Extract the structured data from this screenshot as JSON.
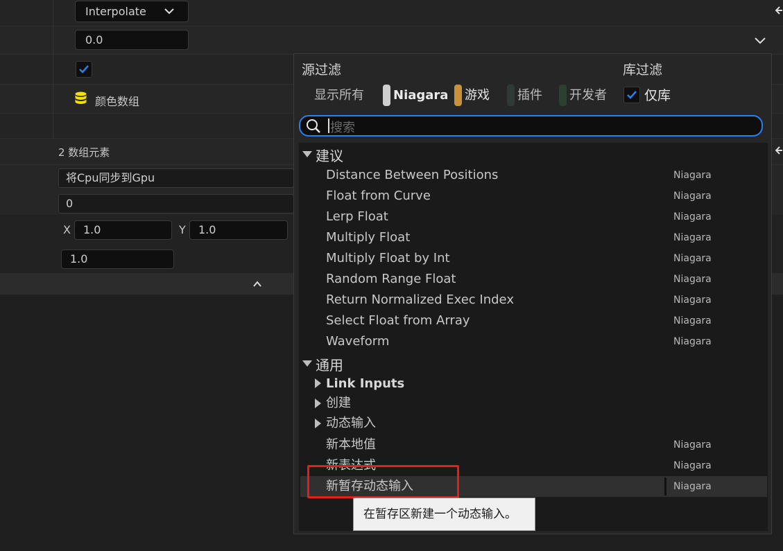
{
  "details": {
    "interp_mode": "Interpolate",
    "float_value": "0.0",
    "color_array_label": "颜色数组",
    "array_count": "2 数组元素",
    "sync_label": "将Cpu同步到Gpu",
    "int_value": "0",
    "x_label": "X",
    "x_value": "1.0",
    "y_label": "Y",
    "y_value": "1.0",
    "scale_value": "1.0"
  },
  "popup": {
    "source_filter_label": "源过滤",
    "library_filter_label": "库过滤",
    "filters": [
      {
        "label": "显示所有"
      },
      {
        "label": "Niagara",
        "color": "#cfcfcf"
      },
      {
        "label": "游戏",
        "color": "#c8923a"
      },
      {
        "label": "插件",
        "color": "#2f3a34"
      },
      {
        "label": "开发者",
        "color": "#2c4032"
      }
    ],
    "library_only_label": "仅库",
    "search_placeholder": "搜索",
    "categories": {
      "suggested": "建议",
      "general": "通用"
    },
    "suggested_items": [
      {
        "name": "Distance Between Positions",
        "source": "Niagara"
      },
      {
        "name": "Float from Curve",
        "source": "Niagara"
      },
      {
        "name": "Lerp Float",
        "source": "Niagara"
      },
      {
        "name": "Multiply Float",
        "source": "Niagara"
      },
      {
        "name": "Multiply Float by Int",
        "source": "Niagara"
      },
      {
        "name": "Random Range Float",
        "source": "Niagara"
      },
      {
        "name": "Return Normalized Exec Index",
        "source": "Niagara"
      },
      {
        "name": "Select Float from Array",
        "source": "Niagara"
      },
      {
        "name": "Waveform",
        "source": "Niagara"
      }
    ],
    "general_groups": [
      "Link Inputs",
      "创建",
      "动态输入"
    ],
    "general_items": [
      {
        "name": "新本地值",
        "source": "Niagara"
      },
      {
        "name": "新表达式",
        "source": "Niagara"
      },
      {
        "name": "新暂存动态输入",
        "source": "Niagara"
      }
    ],
    "tooltip": "在暂存区新建一个动态输入。"
  },
  "colors": {
    "accent": "#2a7ff0",
    "highlight_box": "#e0201c",
    "check": "#2f7fe8"
  }
}
